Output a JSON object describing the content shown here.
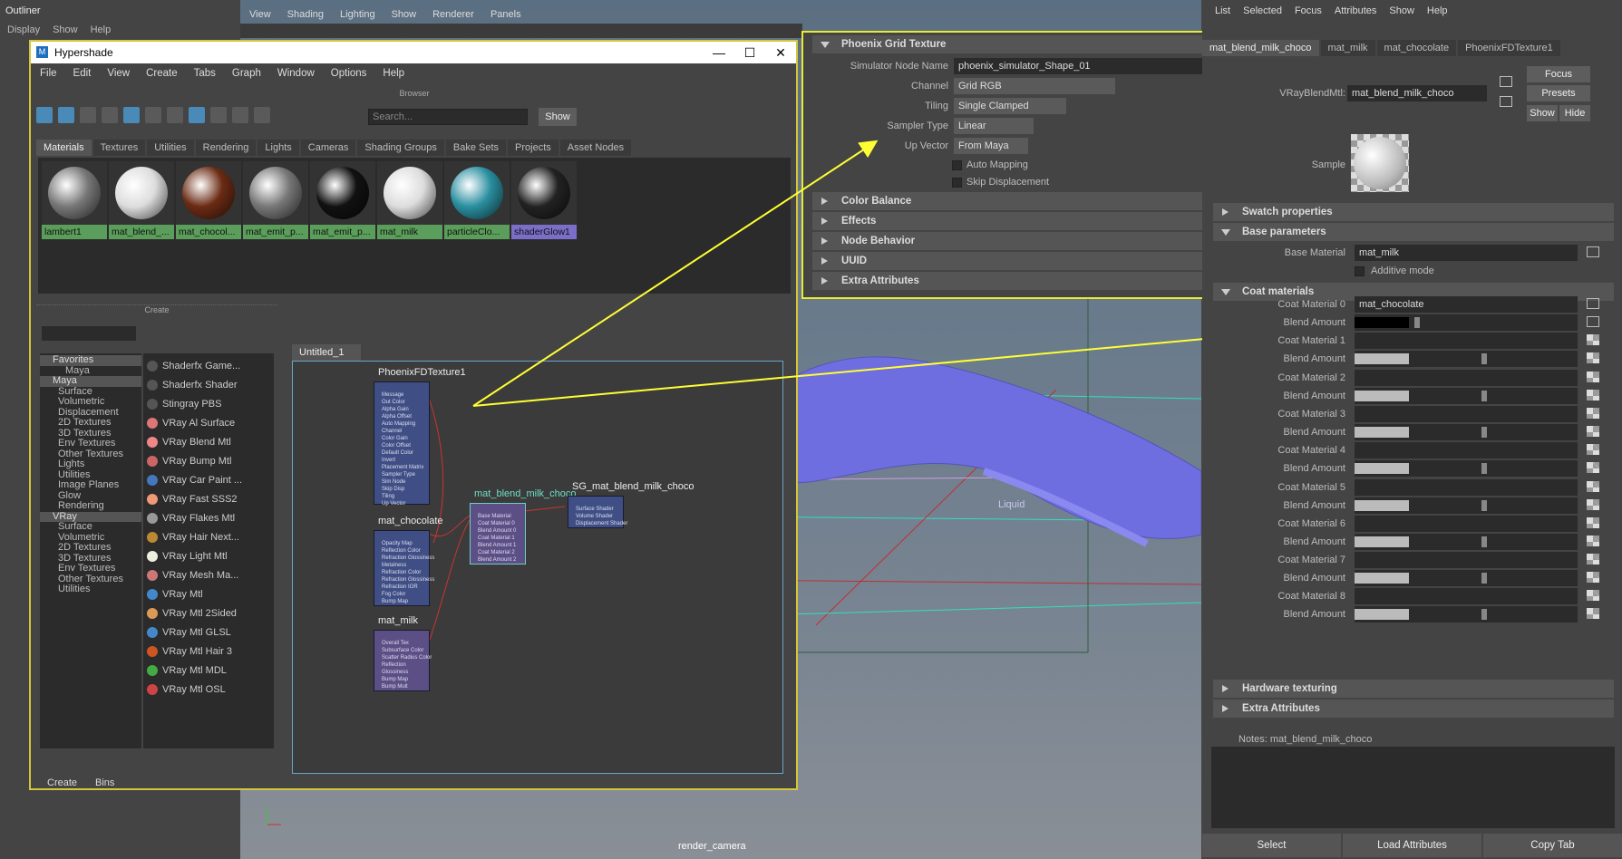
{
  "outliner": {
    "title": "Outliner",
    "menu": [
      "Display",
      "Show",
      "Help"
    ]
  },
  "viewport": {
    "menu": [
      "View",
      "Shading",
      "Lighting",
      "Show",
      "Renderer",
      "Panels"
    ],
    "camera": "render_camera",
    "liquid_label": "Liquid"
  },
  "hypershade": {
    "title": "Hypershade",
    "menu": [
      "File",
      "Edit",
      "View",
      "Create",
      "Tabs",
      "Graph",
      "Window",
      "Options",
      "Help"
    ],
    "browser_label": "Browser",
    "search_placeholder": "Search...",
    "show_label": "Show",
    "tabs": [
      "Materials",
      "Textures",
      "Utilities",
      "Rendering",
      "Lights",
      "Cameras",
      "Shading Groups",
      "Bake Sets",
      "Projects",
      "Asset Nodes"
    ],
    "swatches": [
      {
        "label": "lambert1",
        "color": "#777"
      },
      {
        "label": "mat_blend_...",
        "color": "#ddd"
      },
      {
        "label": "mat_chocol...",
        "color": "#6b2b14"
      },
      {
        "label": "mat_emit_p...",
        "color": "#777"
      },
      {
        "label": "mat_emit_p...",
        "color": "#111"
      },
      {
        "label": "mat_milk",
        "color": "#ddd"
      },
      {
        "label": "particleClo...",
        "color": "#2a8fa0"
      },
      {
        "label": "shaderGlow1",
        "color": "#222"
      }
    ],
    "create_label": "Create",
    "tree": [
      {
        "t": "Favorites",
        "h": true
      },
      {
        "t": "Maya",
        "i": 1
      },
      {
        "t": "Maya",
        "h": true
      },
      {
        "t": "Surface",
        "i": 2
      },
      {
        "t": "Volumetric",
        "i": 2
      },
      {
        "t": "Displacement",
        "i": 2
      },
      {
        "t": "2D Textures",
        "i": 2
      },
      {
        "t": "3D Textures",
        "i": 2
      },
      {
        "t": "Env Textures",
        "i": 2
      },
      {
        "t": "Other Textures",
        "i": 2
      },
      {
        "t": "Lights",
        "i": 2
      },
      {
        "t": "Utilities",
        "i": 2
      },
      {
        "t": "Image Planes",
        "i": 2
      },
      {
        "t": "Glow",
        "i": 2
      },
      {
        "t": "Rendering",
        "i": 2
      },
      {
        "t": "VRay",
        "h": true
      },
      {
        "t": "Surface",
        "i": 2
      },
      {
        "t": "Volumetric",
        "i": 2
      },
      {
        "t": "2D Textures",
        "i": 2
      },
      {
        "t": "3D Textures",
        "i": 2
      },
      {
        "t": "Env Textures",
        "i": 2
      },
      {
        "t": "Other Textures",
        "i": 2
      },
      {
        "t": "Utilities",
        "i": 2
      }
    ],
    "nodes": [
      {
        "t": "Shaderfx Game...",
        "c": "#555"
      },
      {
        "t": "Shaderfx Shader",
        "c": "#555"
      },
      {
        "t": "Stingray PBS",
        "c": "#555"
      },
      {
        "t": "VRay Al Surface",
        "c": "#d77"
      },
      {
        "t": "VRay Blend Mtl",
        "c": "#e88"
      },
      {
        "t": "VRay Bump Mtl",
        "c": "#c66"
      },
      {
        "t": "VRay Car Paint ...",
        "c": "#47b"
      },
      {
        "t": "VRay Fast SSS2",
        "c": "#e97"
      },
      {
        "t": "VRay Flakes Mtl",
        "c": "#999"
      },
      {
        "t": "VRay Hair Next...",
        "c": "#b83"
      },
      {
        "t": "VRay Light Mtl",
        "c": "#eed"
      },
      {
        "t": "VRay Mesh Ma...",
        "c": "#c77"
      },
      {
        "t": "VRay Mtl",
        "c": "#48c"
      },
      {
        "t": "VRay Mtl 2Sided",
        "c": "#d95"
      },
      {
        "t": "VRay Mtl GLSL",
        "c": "#48c"
      },
      {
        "t": "VRay Mtl Hair 3",
        "c": "#c52"
      },
      {
        "t": "VRay Mtl MDL",
        "c": "#4a4"
      },
      {
        "t": "VRay Mtl OSL",
        "c": "#c44"
      }
    ],
    "bottom_tabs": [
      "Create",
      "Bins"
    ],
    "graph_tab": "Untitled_1",
    "graph_nodes": {
      "phoenix": {
        "title": "PhoenixFDTexture1",
        "rows": [
          "Message",
          "Out Color",
          "Alpha Gain",
          "Alpha Offset",
          "Auto Mapping",
          "Channel",
          "Color Gain",
          "Color Offset",
          "Default Color",
          "Invert",
          "Placement Matrix",
          "Sampler Type",
          "Sim Node",
          "Skip Disp",
          "Tiling",
          "Up Vector"
        ]
      },
      "choco": {
        "title": "mat_chocolate",
        "rows": [
          "Opacity Map",
          "Reflection Color",
          "Refraction Glossiness",
          "Metalness",
          "Refraction Color",
          "Refraction Glossiness",
          "Refraction IOR",
          "Fog Color",
          "Bump Map"
        ]
      },
      "milk": {
        "title": "mat_milk",
        "rows": [
          "Overall Tex",
          "Subsurface Color",
          "Scatter Radius Color",
          "Reflection",
          "Glossiness",
          "Bump Map",
          "Bump Mult"
        ]
      },
      "blend": {
        "title": "mat_blend_milk_choco",
        "rows": [
          "Base Material",
          "Coat Material 0",
          "Blend Amount 0",
          "Coat Material 1",
          "Blend Amount 1",
          "Coat Material 2",
          "Blend Amount 2"
        ]
      },
      "sg": {
        "title": "SG_mat_blend_milk_choco",
        "rows": [
          "Surface Shader",
          "Volume Shader",
          "Displacement Shader"
        ]
      }
    }
  },
  "phoenix_panel": {
    "section": "Phoenix Grid Texture",
    "sim_node_label": "Simulator Node Name",
    "sim_node_value": "phoenix_simulator_Shape_01",
    "channel_label": "Channel",
    "channel_value": "Grid RGB",
    "tiling_label": "Tiling",
    "tiling_value": "Single Clamped",
    "sampler_label": "Sampler Type",
    "sampler_value": "Linear",
    "up_label": "Up Vector",
    "up_value": "From Maya",
    "auto_mapping": "Auto Mapping",
    "skip_disp": "Skip Displacement",
    "collapsed": [
      "Color Balance",
      "Effects",
      "Node Behavior",
      "UUID",
      "Extra Attributes"
    ]
  },
  "attr_editor": {
    "menu": [
      "List",
      "Selected",
      "Focus",
      "Attributes",
      "Show",
      "Help"
    ],
    "tabs": [
      "mat_blend_milk_choco",
      "mat_milk",
      "mat_chocolate",
      "PhoenixFDTexture1"
    ],
    "type_label": "VRayBlendMtl:",
    "name_value": "mat_blend_milk_choco",
    "focus": "Focus",
    "presets": "Presets",
    "show": "Show",
    "hide": "Hide",
    "sample_label": "Sample",
    "swatch_props": "Swatch properties",
    "base_params": "Base parameters",
    "base_material_label": "Base Material",
    "base_material_value": "mat_milk",
    "additive_mode": "Additive mode",
    "coat_materials": "Coat materials",
    "coat_rows": [
      {
        "coat": "Coat Material 0",
        "value": "mat_chocolate",
        "blend": "Blend Amount",
        "fill": 0,
        "black": true
      },
      {
        "coat": "Coat Material 1",
        "value": "",
        "blend": "Blend Amount",
        "fill": 1
      },
      {
        "coat": "Coat Material 2",
        "value": "",
        "blend": "Blend Amount",
        "fill": 1
      },
      {
        "coat": "Coat Material 3",
        "value": "",
        "blend": "Blend Amount",
        "fill": 1
      },
      {
        "coat": "Coat Material 4",
        "value": "",
        "blend": "Blend Amount",
        "fill": 1
      },
      {
        "coat": "Coat Material 5",
        "value": "",
        "blend": "Blend Amount",
        "fill": 1
      },
      {
        "coat": "Coat Material 6",
        "value": "",
        "blend": "Blend Amount",
        "fill": 1
      },
      {
        "coat": "Coat Material 7",
        "value": "",
        "blend": "Blend Amount",
        "fill": 1
      },
      {
        "coat": "Coat Material 8",
        "value": "",
        "blend": "Blend Amount",
        "fill": 1
      }
    ],
    "hw_texturing": "Hardware texturing",
    "extra_attrs": "Extra Attributes",
    "notes_label": "Notes:  mat_blend_milk_choco",
    "buttons": [
      "Select",
      "Load Attributes",
      "Copy Tab"
    ]
  }
}
